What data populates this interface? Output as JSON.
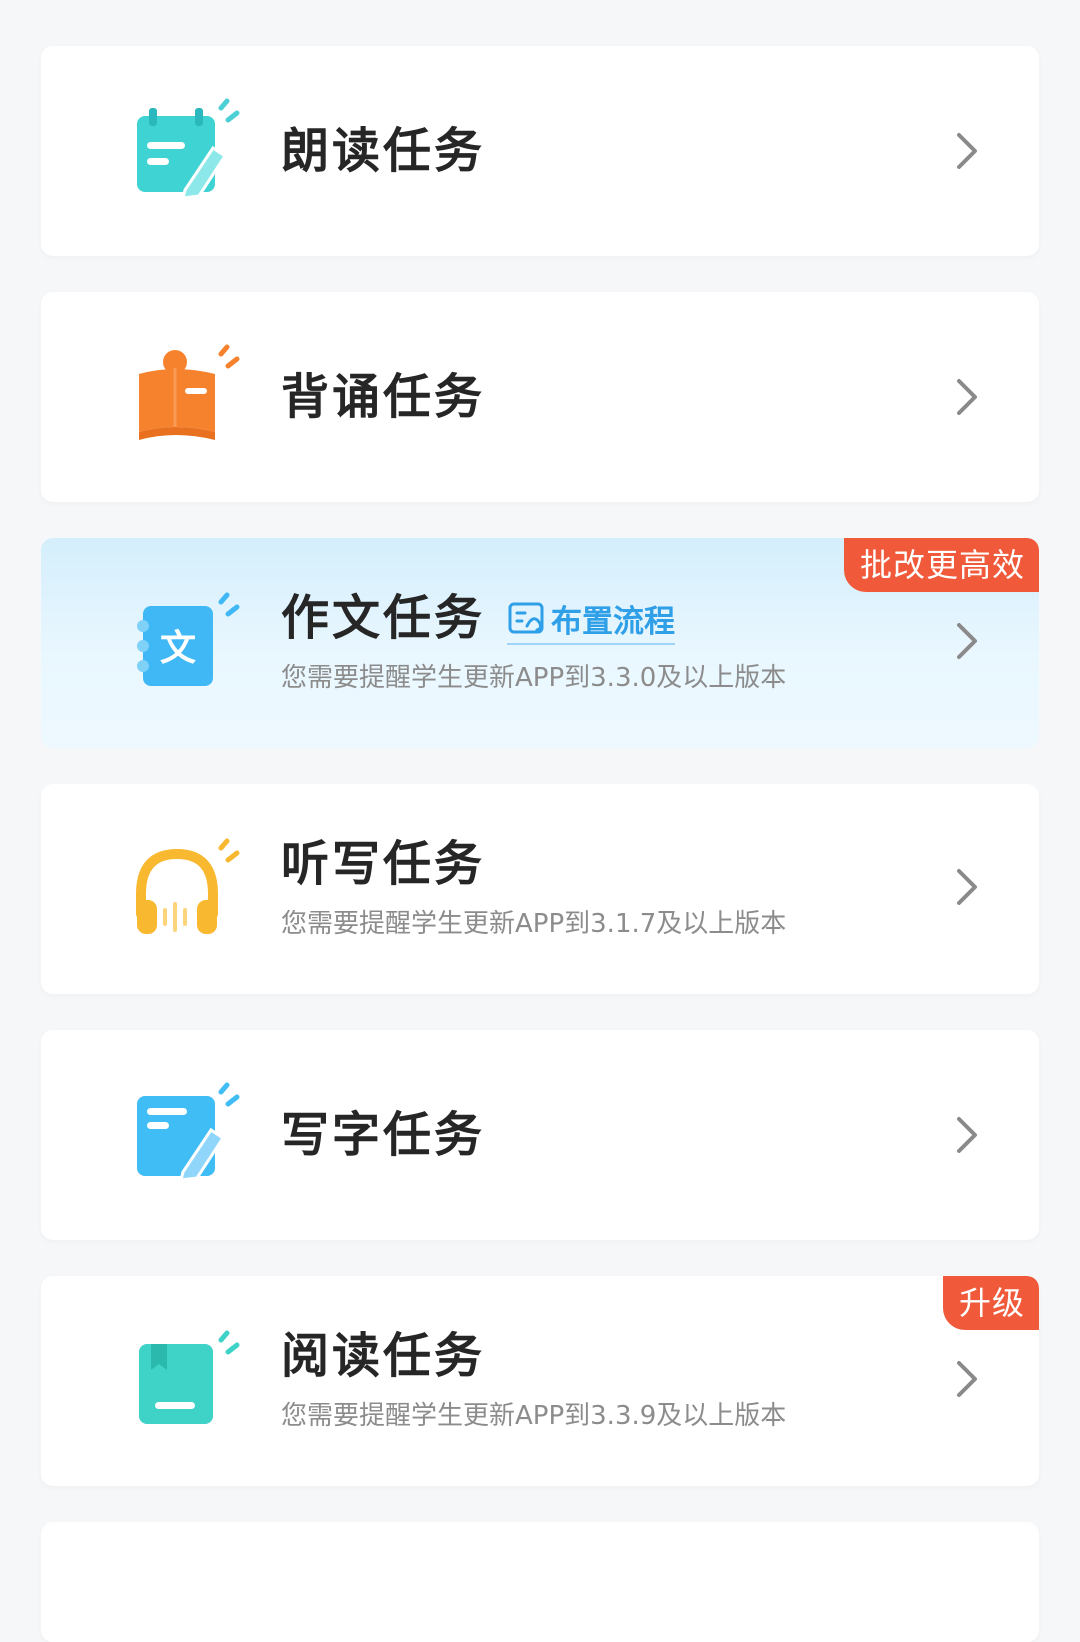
{
  "tasks": [
    {
      "title": "朗读任务",
      "subtitle": "",
      "icon": "calendar-pen-icon",
      "color": "#3fd3d3"
    },
    {
      "title": "背诵任务",
      "subtitle": "",
      "icon": "open-book-icon",
      "color": "#f7822e"
    },
    {
      "title": "作文任务",
      "subtitle": "您需要提醒学生更新APP到3.3.0及以上版本",
      "icon": "composition-notebook-icon",
      "color": "#3fb8f5",
      "badge": "批改更高效",
      "link": "布置流程",
      "link_icon": "flow-icon"
    },
    {
      "title": "听写任务",
      "subtitle": "您需要提醒学生更新APP到3.1.7及以上版本",
      "icon": "headphones-icon",
      "color": "#f8b830"
    },
    {
      "title": "写字任务",
      "subtitle": "",
      "icon": "writing-pad-icon",
      "color": "#41bdf5"
    },
    {
      "title": "阅读任务",
      "subtitle": "您需要提醒学生更新APP到3.3.9及以上版本",
      "icon": "bookmark-book-icon",
      "color": "#3fd3c8",
      "badge": "升级"
    }
  ],
  "colors": {
    "badge": "#f0593a",
    "link": "#2f9fe8",
    "highlight_bg": "#d4eefc"
  }
}
